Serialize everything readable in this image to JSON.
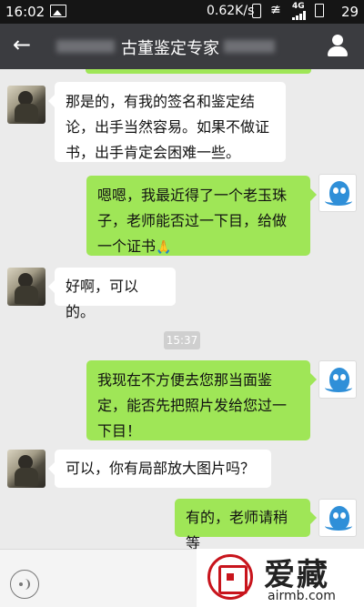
{
  "status_bar": {
    "time": "16:02",
    "net_speed": "0.62K/s",
    "network": "4G",
    "battery": "29"
  },
  "header": {
    "back_icon": "arrow-left-icon",
    "title": "古董鉴定专家",
    "contact_icon": "person-icon"
  },
  "messages": [
    {
      "sender": "expert",
      "text": "那是的，有我的签名和鉴定结论，出手当然容易。如果不做证书，出手肯定会困难一些。"
    },
    {
      "sender": "me",
      "text": "嗯嗯，我最近得了一个老玉珠子，老师能否过一下目，给做一个证书",
      "emoji": "🙏"
    },
    {
      "sender": "expert",
      "text": "好啊，可以的。"
    },
    {
      "sender": "me",
      "text": "我现在不方便去您那当面鉴定，能否先把照片发给您过一下目！"
    },
    {
      "sender": "expert",
      "text": "可以，你有局部放大图片吗？"
    },
    {
      "sender": "me",
      "text": "有的，老师请稍等"
    }
  ],
  "timestamp": "15:37",
  "input_bar": {
    "voice_icon": "voice-icon"
  },
  "watermark": {
    "brand": "爱藏",
    "url": "airmb.com"
  },
  "colors": {
    "title_bar": "#3b3c40",
    "sent_bubble": "#9fe657",
    "received_bubble": "#ffffff",
    "chat_background": "#ebebeb"
  }
}
